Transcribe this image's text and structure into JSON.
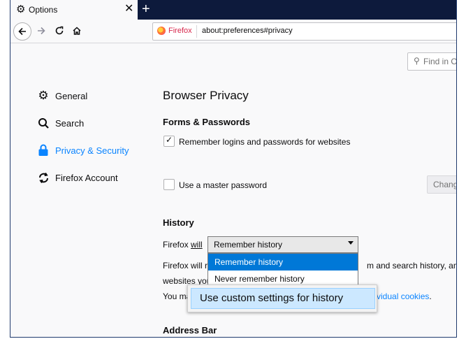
{
  "tab": {
    "title": "Options",
    "icon": "gear-icon",
    "close": "✕",
    "new_tab": "+"
  },
  "nav": {
    "back": "back-arrow-icon",
    "forward": "forward-arrow-icon",
    "reload": "reload-icon",
    "home": "home-icon"
  },
  "urlbar": {
    "identity": "Firefox",
    "url": "about:preferences#privacy"
  },
  "find": {
    "placeholder": "Find in O"
  },
  "sidebar": {
    "items": [
      {
        "label": "General",
        "icon": "gear-icon"
      },
      {
        "label": "Search",
        "icon": "search-icon"
      },
      {
        "label": "Privacy & Security",
        "icon": "lock-icon",
        "active": true
      },
      {
        "label": "Firefox Account",
        "icon": "sync-icon"
      }
    ]
  },
  "main": {
    "page_title": "Browser Privacy",
    "forms": {
      "heading": "Forms & Passwords",
      "remember_logins": "Remember logins and passwords for websites",
      "master_password": "Use a master password",
      "change_button": "Chang"
    },
    "history": {
      "heading": "History",
      "will_prefix": "Firefox ",
      "will_word": "will",
      "selected": "Remember history",
      "options": [
        "Remember history",
        "Never remember history",
        "Use custom settings for history"
      ],
      "line1_left": "Firefox will r",
      "line1_right": "m and search history, and k",
      "line2_left": "websites you",
      "line3_left": "You ma",
      "line3_link": "vidual cookies",
      "line3_end": "."
    },
    "address_bar": {
      "heading": "Address Bar"
    }
  },
  "colors": {
    "accent": "#0a84ff",
    "selection": "#0078d7",
    "tabstrip": "#0d1a3c"
  }
}
